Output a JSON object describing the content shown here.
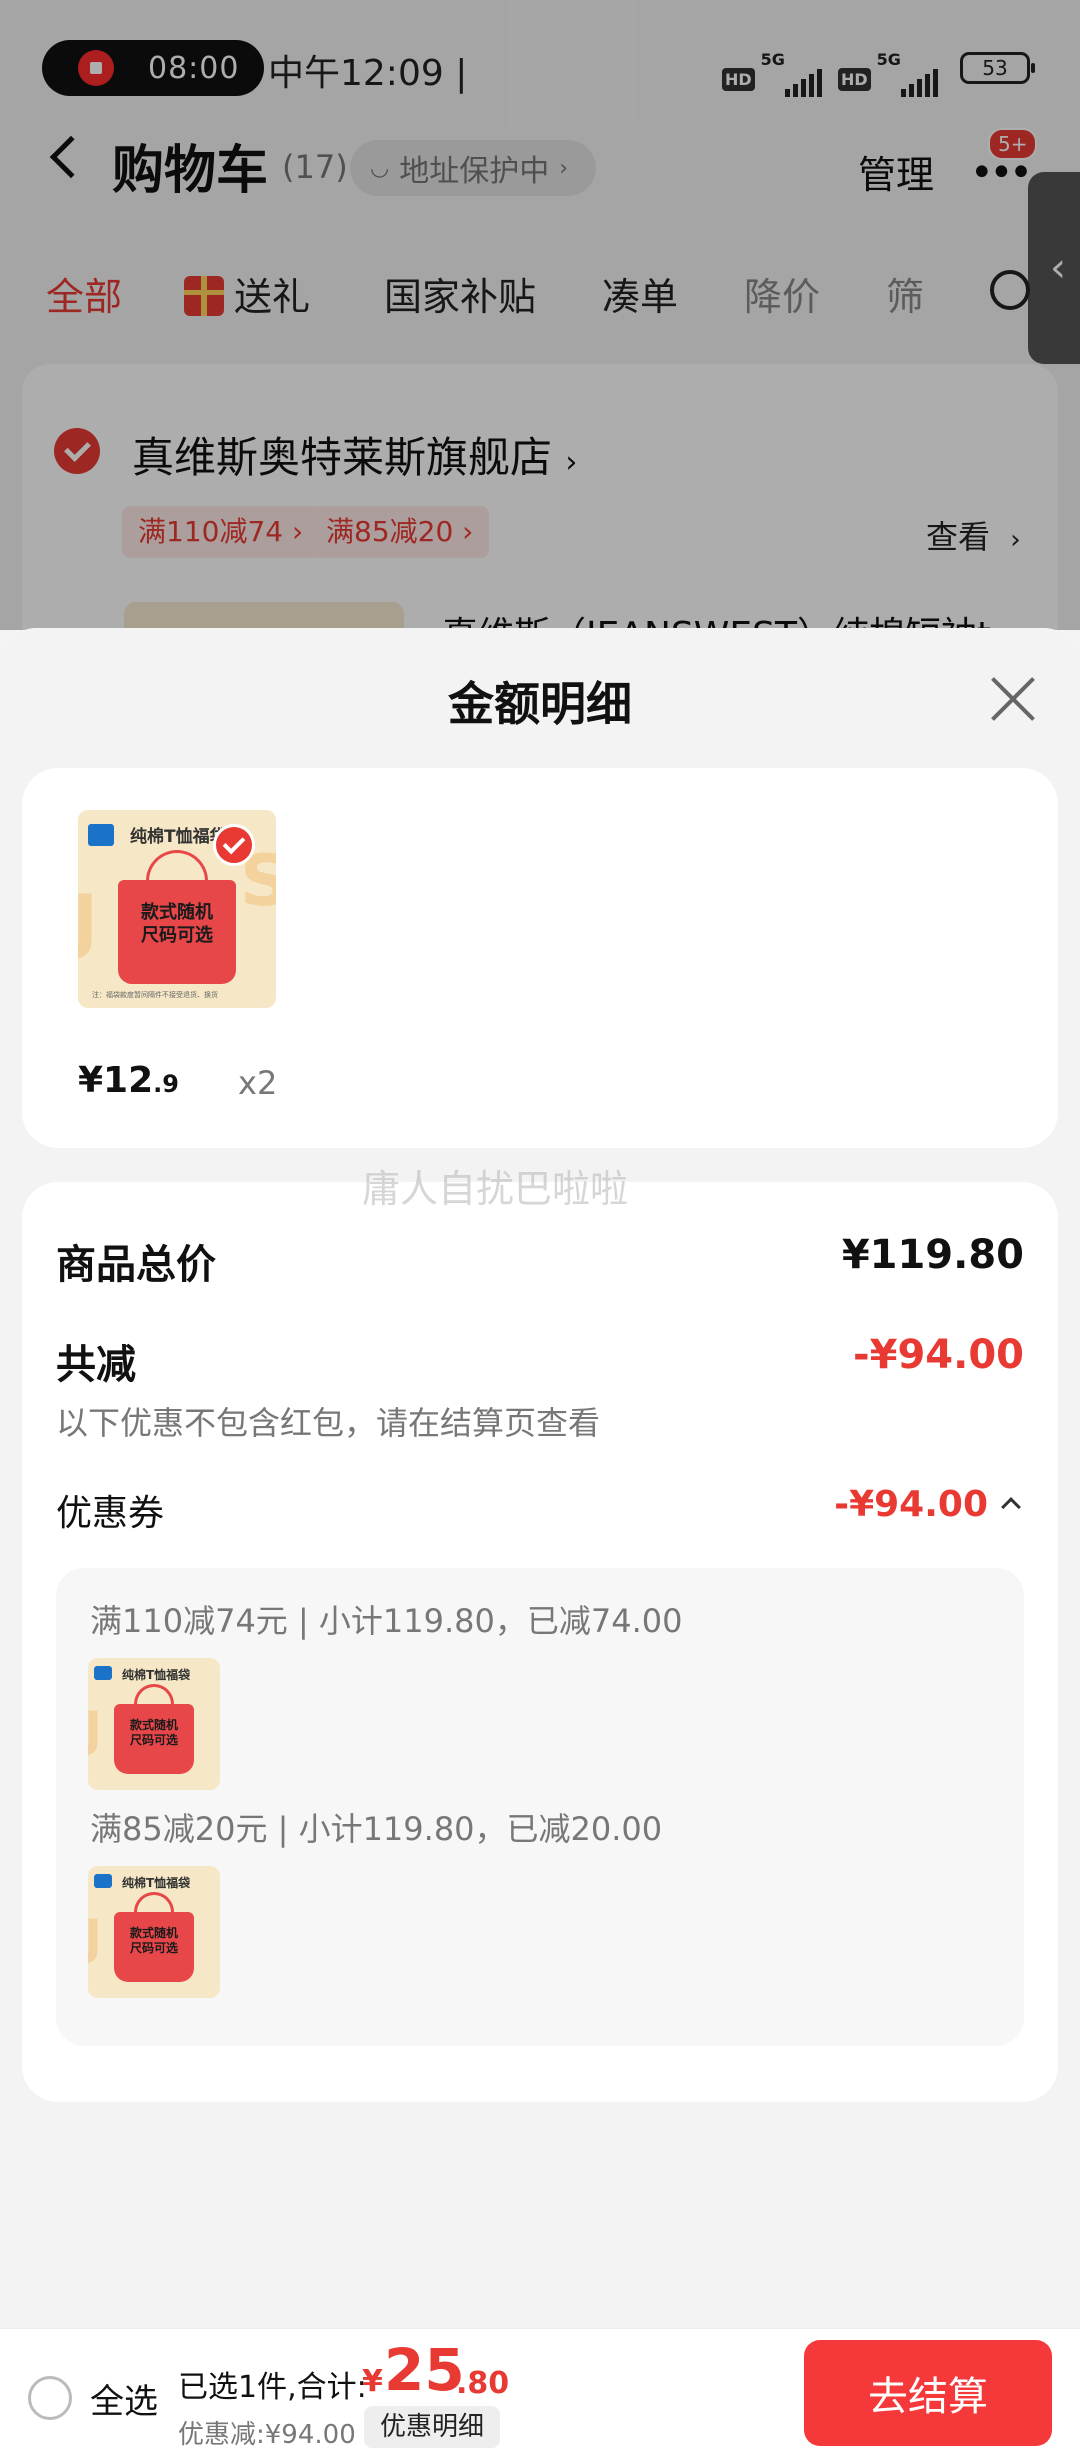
{
  "status_bar": {
    "rec_time": "08:00",
    "clock": "中午12:09 |",
    "hd": "HD",
    "network": "5G",
    "battery": "53"
  },
  "header": {
    "title": "购物车",
    "count": "(17)",
    "address": "地址保护中",
    "manage": "管理",
    "badge": "5+"
  },
  "filter_tabs": [
    {
      "label": "全部"
    },
    {
      "label": "送礼"
    },
    {
      "label": "国家补贴"
    },
    {
      "label": "凑单"
    },
    {
      "label": "降价"
    },
    {
      "label": "筛"
    }
  ],
  "store": {
    "name": "真维斯奥特莱斯旗舰店",
    "promos": [
      "满110减74",
      "满85减20"
    ],
    "view": "查看",
    "product_title": "真维斯（JEANSWEST）纯棉短袖t"
  },
  "sheet": {
    "title": "金额明细",
    "item": {
      "price_int": "¥12",
      "price_dec": ".9",
      "qty": "x2"
    },
    "product_image": {
      "title": "纯棉T恤福袋",
      "bag_text_1": "款式随机",
      "bag_text_2": "尺码可选",
      "footnote": "注：福袋款度暂间隔件不接受退货、换货"
    },
    "watermark": "庸人自扰巴啦啦",
    "total_label": "商品总价",
    "total_value": "¥119.80",
    "reduce_label": "共减",
    "reduce_value": "-¥94.00",
    "note": "以下优惠不包含红包，请在结算页查看",
    "coupon_label": "优惠券",
    "coupon_value": "-¥94.00",
    "coupon_lines": [
      "满110减74元 | 小计119.80，已减74.00",
      "满85减20元 | 小计119.80，已减20.00"
    ]
  },
  "bottom_bar": {
    "select_all": "全选",
    "selected": "已选1件,合计:",
    "yen": "¥",
    "total_int": "25",
    "total_dec": ".80",
    "discount": "优惠减:¥94.00",
    "detail": "优惠明细",
    "checkout": "去结算"
  },
  "colors": {
    "accent": "#e83a33",
    "checkout": "#f5383a",
    "background": "#f3f3f3"
  }
}
